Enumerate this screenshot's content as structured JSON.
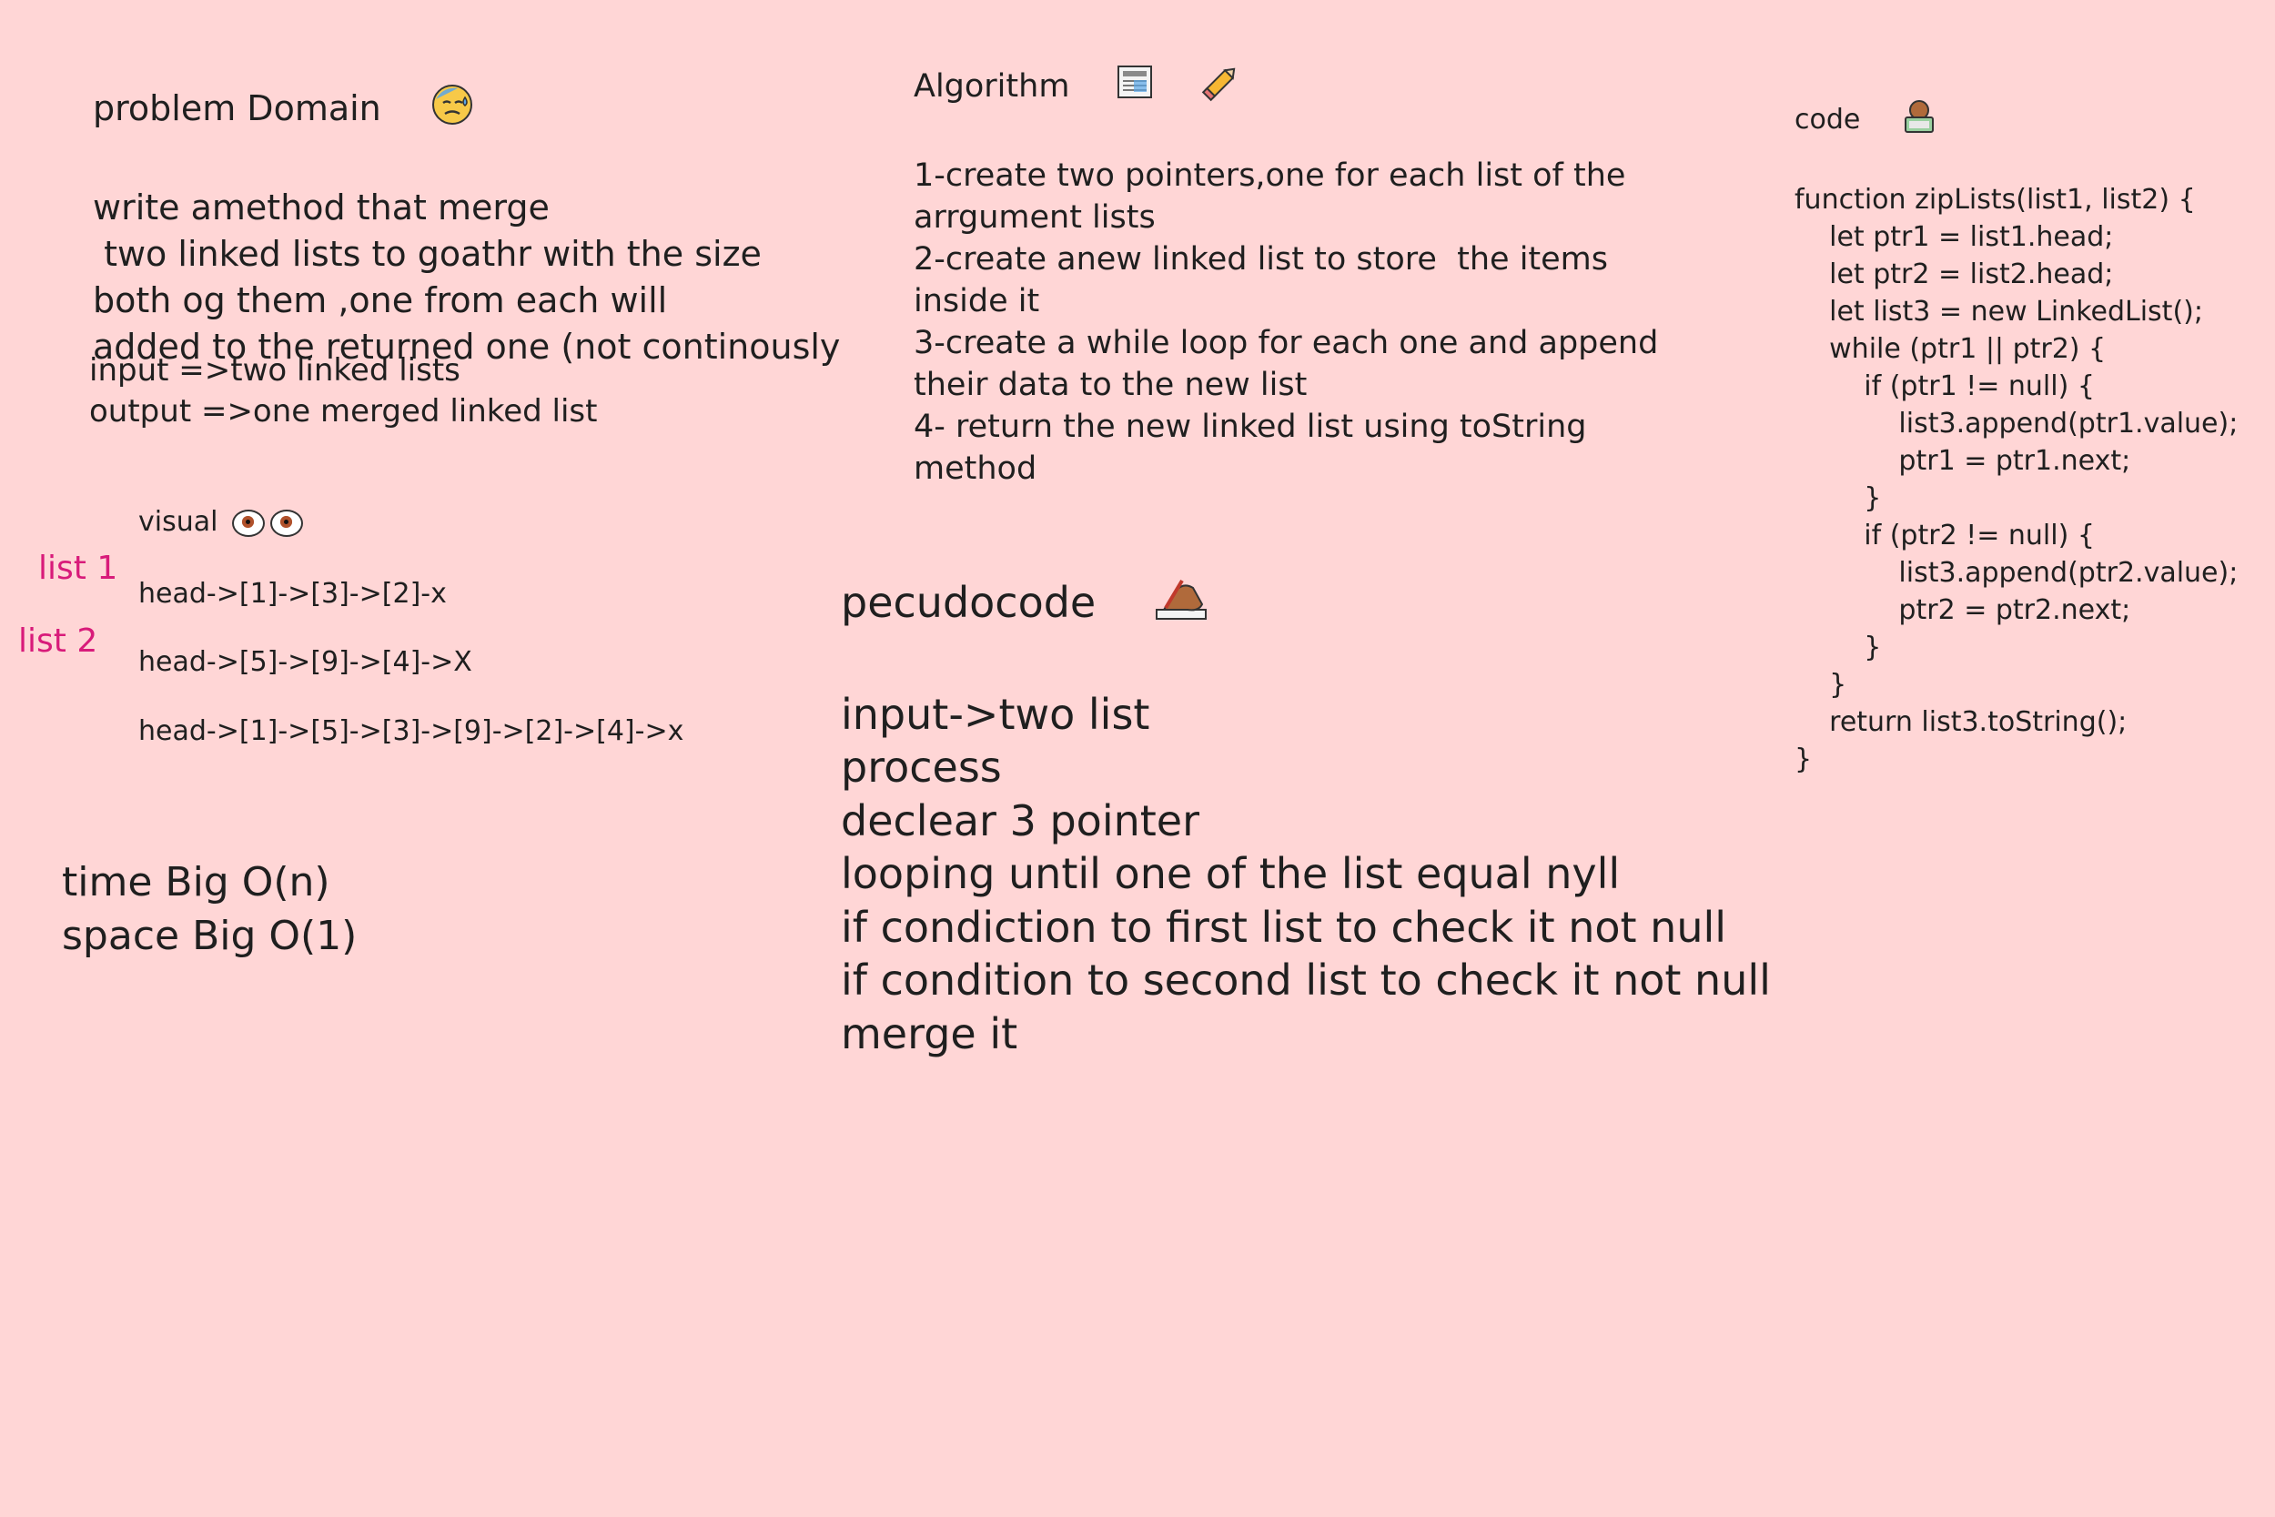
{
  "problem": {
    "lines": [
      "problem Domain",
      "write amethod that merge",
      " two linked lists to goathr with the size",
      "both og them ,one from each will",
      "added to the returned one (not continously"
    ]
  },
  "io": {
    "input": "input =>two linked lists",
    "output": "output =>one merged linked list"
  },
  "visual": {
    "title": "visual",
    "list1_label": "list 1",
    "list2_label": "list 2",
    "rows": [
      "head->[1]->[3]->[2]-x",
      "head->[5]->[9]->[4]->X",
      "head->[1]->[5]->[3]->[9]->[2]->[4]->x"
    ]
  },
  "bigo": {
    "time": "time Big O(n)",
    "space": "space Big O(1)"
  },
  "algorithm": {
    "title": "Algorithm",
    "lines": [
      "1-create two pointers,one for each list of the",
      "arrgument lists",
      "2-create anew linked list to store  the items",
      "inside it",
      "3-create a while loop for each one and append",
      "their data to the new list",
      "4- return the new linked list using toString",
      "method"
    ]
  },
  "pseudo": {
    "title": "pecudocode",
    "lines": [
      "input->two list",
      "process",
      "declear 3 pointer",
      "looping until one of the list equal nyll",
      "if condiction to first list to check it not null",
      "if condition to second list to check it not null",
      "merge it"
    ]
  },
  "code": {
    "title": "code",
    "lines": [
      "function zipLists(list1, list2) {",
      "    let ptr1 = list1.head;",
      "    let ptr2 = list2.head;",
      "    let list3 = new LinkedList();",
      "",
      "    while (ptr1 || ptr2) {",
      "        if (ptr1 != null) {",
      "            list3.append(ptr1.value);",
      "            ptr1 = ptr1.next;",
      "        }",
      "        if (ptr2 != null) {",
      "            list3.append(ptr2.value);",
      "            ptr2 = ptr2.next;",
      "        }",
      "    }",
      "    return list3.toString();",
      "}"
    ]
  },
  "icons": {
    "problem": "sad-sweat-face-icon",
    "algorithm_1": "newspaper-icon",
    "algorithm_2": "pencil-icon",
    "visual": "eyes-icon",
    "pseudo": "writing-hand-icon",
    "code": "technologist-icon"
  }
}
